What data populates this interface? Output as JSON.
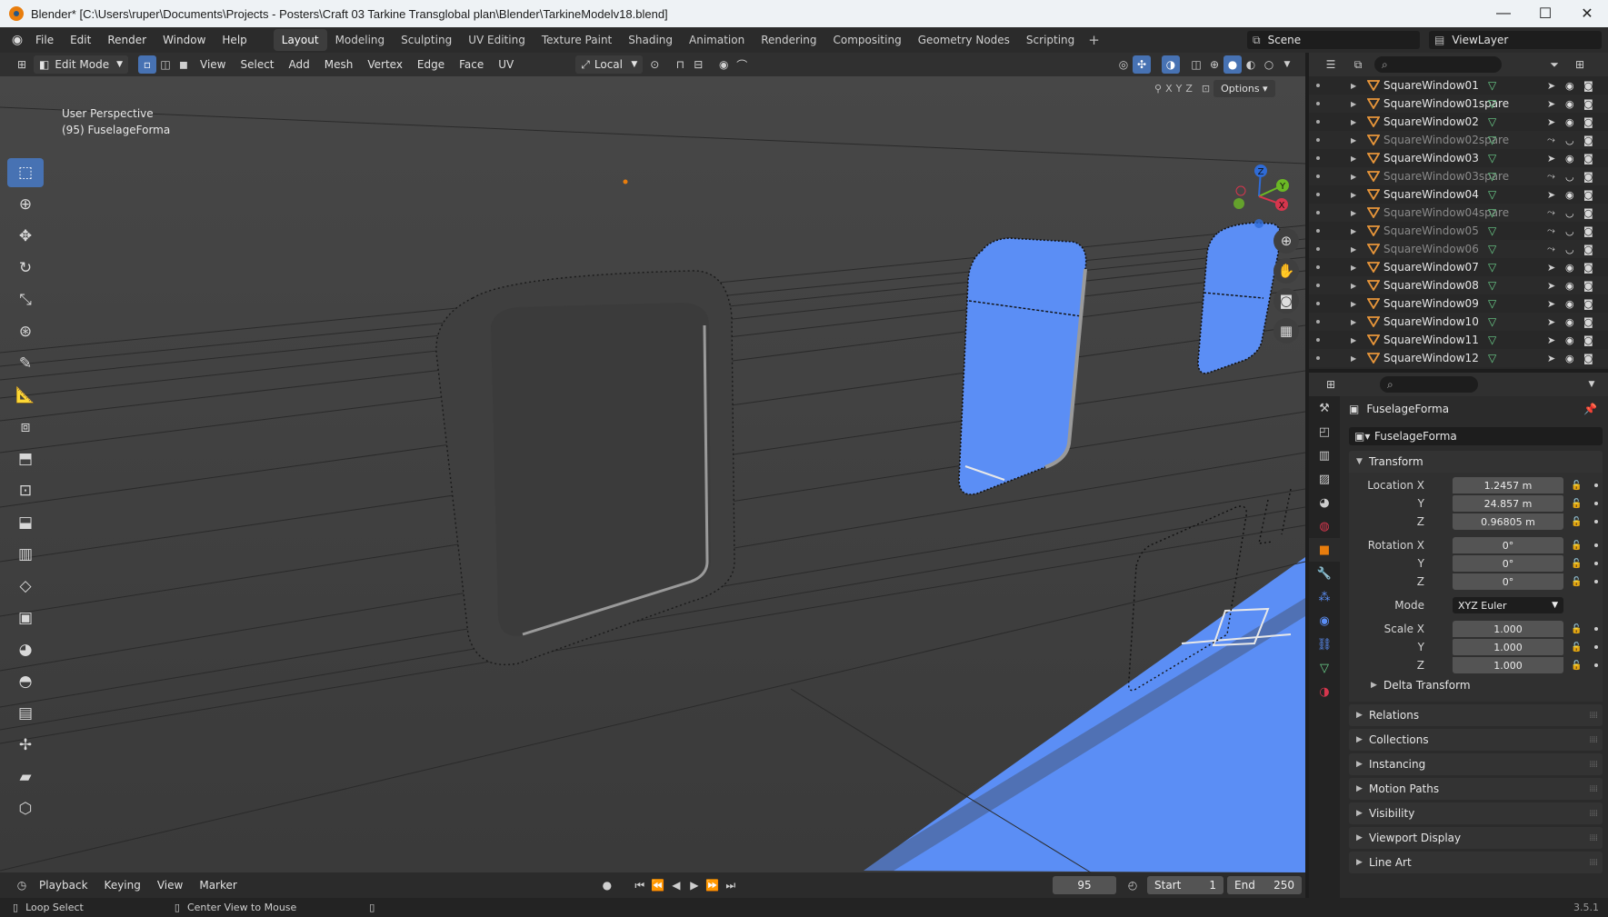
{
  "window": {
    "title": "Blender* [C:\\Users\\ruper\\Documents\\Projects - Posters\\Craft 03 Tarkine Transglobal plan\\Blender\\TarkineModelv18.blend]",
    "minimize": "—",
    "maximize": "☐",
    "close": "✕"
  },
  "menubar": {
    "items": [
      "File",
      "Edit",
      "Render",
      "Window",
      "Help"
    ],
    "workspaces": [
      "Layout",
      "Modeling",
      "Sculpting",
      "UV Editing",
      "Texture Paint",
      "Shading",
      "Animation",
      "Rendering",
      "Compositing",
      "Geometry Nodes",
      "Scripting"
    ],
    "active_workspace": "Layout",
    "add_workspace": "+",
    "scene": "Scene",
    "view_layer": "ViewLayer"
  },
  "viewport": {
    "mode": "Edit Mode",
    "menus": [
      "View",
      "Select",
      "Add",
      "Mesh",
      "Vertex",
      "Edge",
      "Face",
      "UV"
    ],
    "transform_orientation": "Local",
    "overlay_line1": "User Perspective",
    "overlay_line2": "(95) FuselageForma",
    "axis_labels": [
      "X",
      "Y",
      "Z"
    ],
    "options_label": "Options",
    "gizmo_labels": {
      "x": "X",
      "y": "Y",
      "z": "Z"
    },
    "colors": {
      "glass": "#5b8ef5",
      "hull": "#3b3b3b",
      "vertex": "#000000",
      "accent": "#4772b3"
    }
  },
  "tools": [
    "select-box",
    "cursor",
    "move",
    "rotate",
    "scale",
    "transform",
    "annotate",
    "measure",
    "add-cube",
    "extrude",
    "inset",
    "bevel",
    "loop-cut",
    "knife",
    "poly-build",
    "spin",
    "smooth",
    "edge-slide",
    "shrink-fatten",
    "shear",
    "rip"
  ],
  "timeline": {
    "menus": [
      "Playback",
      "Keying",
      "View",
      "Marker"
    ],
    "current_frame": "95",
    "start_label": "Start",
    "start": "1",
    "end_label": "End",
    "end": "250"
  },
  "statusbar": {
    "left_action": "Loop Select",
    "mid_action": "Center View to Mouse",
    "version": "3.5.1"
  },
  "outliner": {
    "rows": [
      {
        "name": "SquareWindow01",
        "dim": false,
        "selectable": true
      },
      {
        "name": "SquareWindow01spare",
        "dim": false,
        "selectable": true
      },
      {
        "name": "SquareWindow02",
        "dim": false,
        "selectable": true
      },
      {
        "name": "SquareWindow02spare",
        "dim": true,
        "selectable": false
      },
      {
        "name": "SquareWindow03",
        "dim": false,
        "selectable": true
      },
      {
        "name": "SquareWindow03spare",
        "dim": true,
        "selectable": false
      },
      {
        "name": "SquareWindow04",
        "dim": false,
        "selectable": true
      },
      {
        "name": "SquareWindow04spare",
        "dim": true,
        "selectable": false
      },
      {
        "name": "SquareWindow05",
        "dim": true,
        "selectable": false
      },
      {
        "name": "SquareWindow06",
        "dim": true,
        "selectable": false
      },
      {
        "name": "SquareWindow07",
        "dim": false,
        "selectable": true
      },
      {
        "name": "SquareWindow08",
        "dim": false,
        "selectable": true
      },
      {
        "name": "SquareWindow09",
        "dim": false,
        "selectable": true
      },
      {
        "name": "SquareWindow10",
        "dim": false,
        "selectable": true
      },
      {
        "name": "SquareWindow11",
        "dim": false,
        "selectable": true
      },
      {
        "name": "SquareWindow12",
        "dim": false,
        "selectable": true
      }
    ]
  },
  "properties": {
    "object_name": "FuselageForma",
    "object_field": "FuselageForma",
    "transform_label": "Transform",
    "location": {
      "label": "Location X",
      "x": "1.2457 m",
      "y_label": "Y",
      "y": "24.857 m",
      "z_label": "Z",
      "z": "0.96805 m"
    },
    "rotation": {
      "label": "Rotation X",
      "x": "0°",
      "y_label": "Y",
      "y": "0°",
      "z_label": "Z",
      "z": "0°"
    },
    "mode": {
      "label": "Mode",
      "value": "XYZ Euler"
    },
    "scale": {
      "label": "Scale X",
      "x": "1.000",
      "y_label": "Y",
      "y": "1.000",
      "z_label": "Z",
      "z": "1.000"
    },
    "delta_transform": "Delta Transform",
    "panels": [
      "Relations",
      "Collections",
      "Instancing",
      "Motion Paths",
      "Visibility",
      "Viewport Display",
      "Line Art"
    ]
  }
}
